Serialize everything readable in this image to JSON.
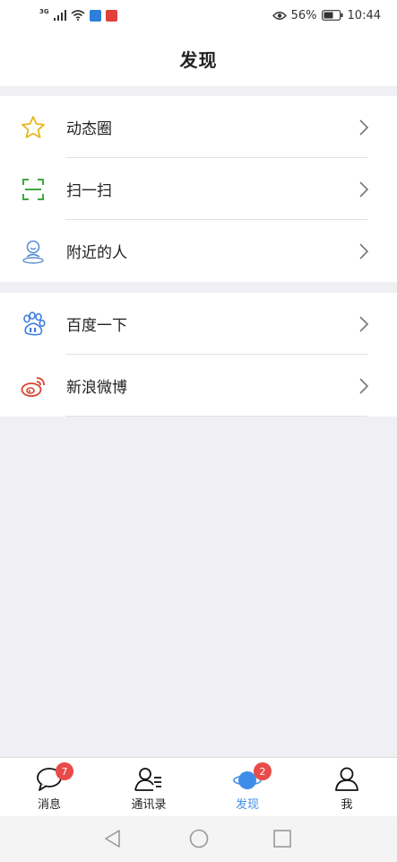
{
  "status_bar": {
    "network_tag": "3G",
    "battery_percent": "56%",
    "time": "10:44",
    "icons": [
      "signal-icon",
      "wifi-icon",
      "app-notification-icon",
      "eye-icon",
      "battery-icon"
    ]
  },
  "header": {
    "title": "发现"
  },
  "groups": [
    {
      "items": [
        {
          "label": "动态圈",
          "icon": "star-icon",
          "color": "#e6b820"
        },
        {
          "label": "扫一扫",
          "icon": "scan-icon",
          "color": "#3fa940"
        },
        {
          "label": "附近的人",
          "icon": "nearby-person-icon",
          "color": "#5a8fd6"
        }
      ]
    },
    {
      "items": [
        {
          "label": "百度一下",
          "icon": "baidu-paw-icon",
          "color": "#3f7ee0"
        },
        {
          "label": "新浪微博",
          "icon": "weibo-icon",
          "color": "#d9452e"
        }
      ]
    }
  ],
  "tab_bar": {
    "tabs": [
      {
        "label": "消息",
        "icon": "chat-bubble-icon",
        "badge": "7",
        "active": false
      },
      {
        "label": "通讯录",
        "icon": "contacts-icon",
        "badge": "",
        "active": false
      },
      {
        "label": "发现",
        "icon": "planet-icon",
        "badge": "2",
        "active": true
      },
      {
        "label": "我",
        "icon": "person-icon",
        "badge": "",
        "active": false
      }
    ],
    "active_color": "#3e8ee8",
    "badge_color": "#e94a4a"
  },
  "system_nav": {
    "buttons": [
      "back-icon",
      "home-icon",
      "recents-icon"
    ]
  }
}
